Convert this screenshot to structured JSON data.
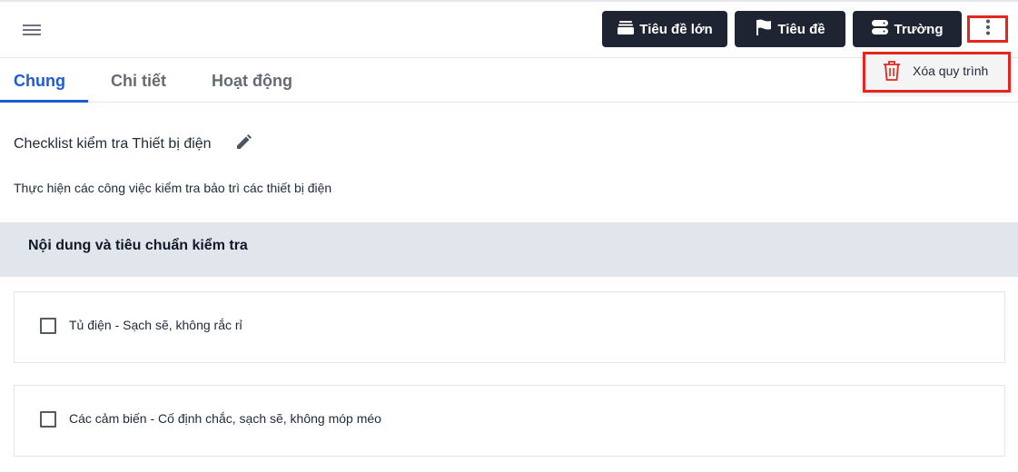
{
  "toolbar": {
    "big_title_label": "Tiêu đề lớn",
    "title_label": "Tiêu đề",
    "field_label": "Trường",
    "icons": {
      "menu": "hamburger-menu-icon",
      "big_title": "stack-icon",
      "title": "flag-icon",
      "field": "database-icon",
      "more": "vertical-dots-icon"
    },
    "button_color": "#1e2431"
  },
  "dropdown": {
    "delete_label": "Xóa quy trình",
    "icon": "trash-icon",
    "icon_color": "#e4261e"
  },
  "tabs": [
    {
      "label": "Chung",
      "active": true
    },
    {
      "label": "Chi tiết",
      "active": false
    },
    {
      "label": "Hoạt động",
      "active": false
    }
  ],
  "accent_color": "#1d5bd6",
  "highlight_color": "#e4261e",
  "process": {
    "title": "Checklist kiểm tra Thiết bị điện",
    "description": "Thực hiện các công việc kiểm tra bảo trì các thiết bị điện"
  },
  "section": {
    "title": "Nội dung và tiêu chuẩn kiểm tra"
  },
  "items": [
    {
      "label": "Tủ điện - Sạch sẽ, không rắc rỉ",
      "checked": false
    },
    {
      "label": "Các cảm biến - Cố định chắc, sạch sẽ, không móp méo",
      "checked": false
    }
  ]
}
